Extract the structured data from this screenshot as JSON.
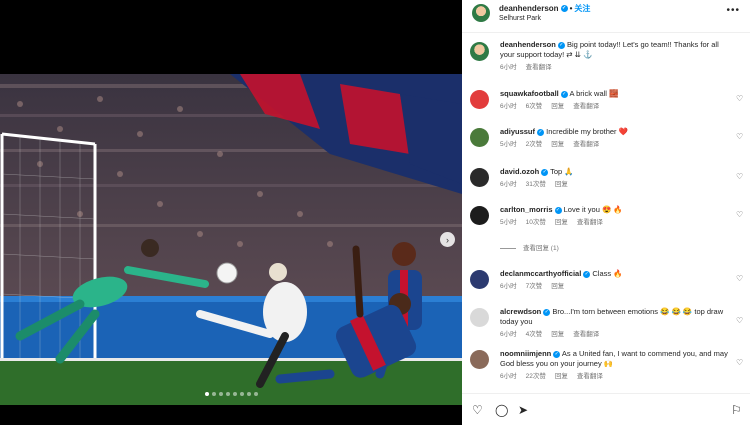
{
  "post": {
    "username": "deanhenderson",
    "follow_label": "关注",
    "location": "Selhurst Park",
    "slide_count": 8,
    "active_slide": 0
  },
  "caption": {
    "username": "deanhenderson",
    "text": "Big point today!! Let's go team!! Thanks for all your support today! ⇄ ⇊ ⚓",
    "time": "6小时",
    "translate": "查看翻译"
  },
  "comments": [
    {
      "username": "squawkafootball",
      "text": "A brick wall 🧱",
      "time": "6小时",
      "likes": "6次赞",
      "reply": "回复",
      "translate": "查看翻译",
      "avatar_color": "#e23c3c"
    },
    {
      "username": "adiyussuf",
      "text": "Incredible my brother ❤️",
      "time": "5小时",
      "likes": "2次赞",
      "reply": "回复",
      "translate": "查看翻译",
      "avatar_color": "#4a7a3a"
    },
    {
      "username": "david.ozoh",
      "text": "Top 🙏",
      "time": "6小时",
      "likes": "31次赞",
      "reply": "回复",
      "translate": "",
      "avatar_color": "#2a2a2a"
    },
    {
      "username": "carlton_morris",
      "text": "Love it you 😍 🔥",
      "time": "5小时",
      "likes": "10次赞",
      "reply": "回复",
      "translate": "查看翻译",
      "avatar_color": "#1c1c1c",
      "view_replies": "查看回复 (1)"
    },
    {
      "username": "declanmccarthyofficial",
      "text": "Class 🔥",
      "time": "6小时",
      "likes": "7次赞",
      "reply": "回复",
      "translate": "",
      "avatar_color": "#2c3a70"
    },
    {
      "username": "alcrewdson",
      "text": "Bro...I'm torn between emotions 😂 😂 😂 top draw today you",
      "time": "6小时",
      "likes": "4次赞",
      "reply": "回复",
      "translate": "查看翻译",
      "avatar_color": "#d9d9d9"
    },
    {
      "username": "noomniimjenn",
      "text": "As a United fan, I want to commend you, and may God bless you on your journey 🙌",
      "time": "6小时",
      "likes": "22次赞",
      "reply": "回复",
      "translate": "查看翻译",
      "avatar_color": "#8a6a5a"
    }
  ],
  "icons": {
    "like": "heart-icon",
    "comment": "comment-icon",
    "share": "send-icon",
    "save": "bookmark-icon"
  },
  "colors": {
    "link_blue": "#0095f6",
    "palace_blue": "#1b458f",
    "palace_red": "#c4122e",
    "keeper_green": "#2bb48a",
    "pitch_green": "#2f6e2a"
  }
}
